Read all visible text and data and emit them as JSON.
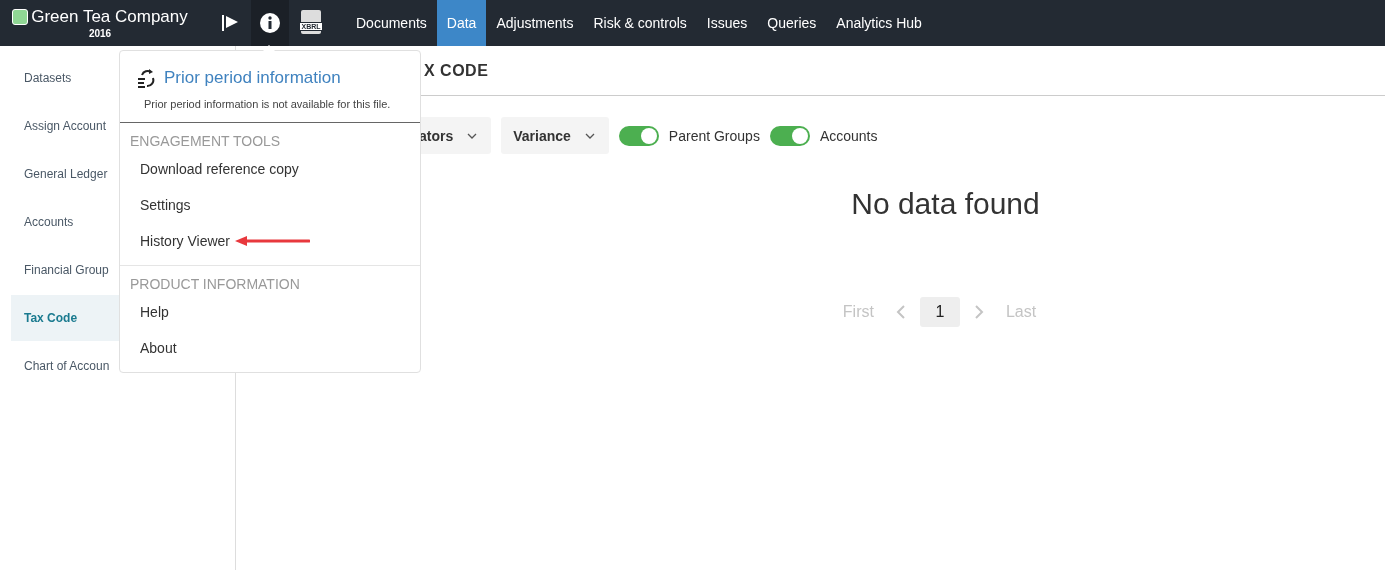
{
  "topbar": {
    "company": "Green Tea Company",
    "year": "2016",
    "xbrl_label": "XBRL",
    "nav": [
      {
        "label": "Documents",
        "selected": false
      },
      {
        "label": "Data",
        "selected": true
      },
      {
        "label": "Adjustments",
        "selected": false
      },
      {
        "label": "Risk & controls",
        "selected": false
      },
      {
        "label": "Issues",
        "selected": false
      },
      {
        "label": "Queries",
        "selected": false
      },
      {
        "label": "Analytics Hub",
        "selected": false
      }
    ]
  },
  "sidebar": {
    "items": [
      {
        "label": "Datasets",
        "selected": false
      },
      {
        "label": "Assign Account",
        "selected": false
      },
      {
        "label": "General Ledger",
        "selected": false
      },
      {
        "label": "Accounts",
        "selected": false
      },
      {
        "label": "Financial Group",
        "selected": false
      },
      {
        "label": "Tax Code",
        "selected": true
      },
      {
        "label": "Chart of Accoun",
        "selected": false
      }
    ]
  },
  "main": {
    "title": "X CODE",
    "filters": [
      {
        "kind": "dropdown",
        "label": "ators"
      },
      {
        "kind": "dropdown",
        "label": "Variance"
      },
      {
        "kind": "toggle",
        "label": "Parent Groups",
        "on": true
      },
      {
        "kind": "toggle",
        "label": "Accounts",
        "on": true
      }
    ],
    "empty_message": "No data found",
    "pagination": {
      "first": "First",
      "page": "1",
      "last": "Last"
    }
  },
  "popup": {
    "title": "Prior period information",
    "note": "Prior period information is not available for this file.",
    "sections": [
      {
        "heading": "ENGAGEMENT TOOLS",
        "items": [
          {
            "label": "Download reference copy",
            "annotated": false
          },
          {
            "label": "Settings",
            "annotated": false
          },
          {
            "label": "History Viewer",
            "annotated": true
          }
        ]
      },
      {
        "heading": "PRODUCT INFORMATION",
        "items": [
          {
            "label": "Help",
            "annotated": false
          },
          {
            "label": "About",
            "annotated": false
          }
        ]
      }
    ]
  }
}
